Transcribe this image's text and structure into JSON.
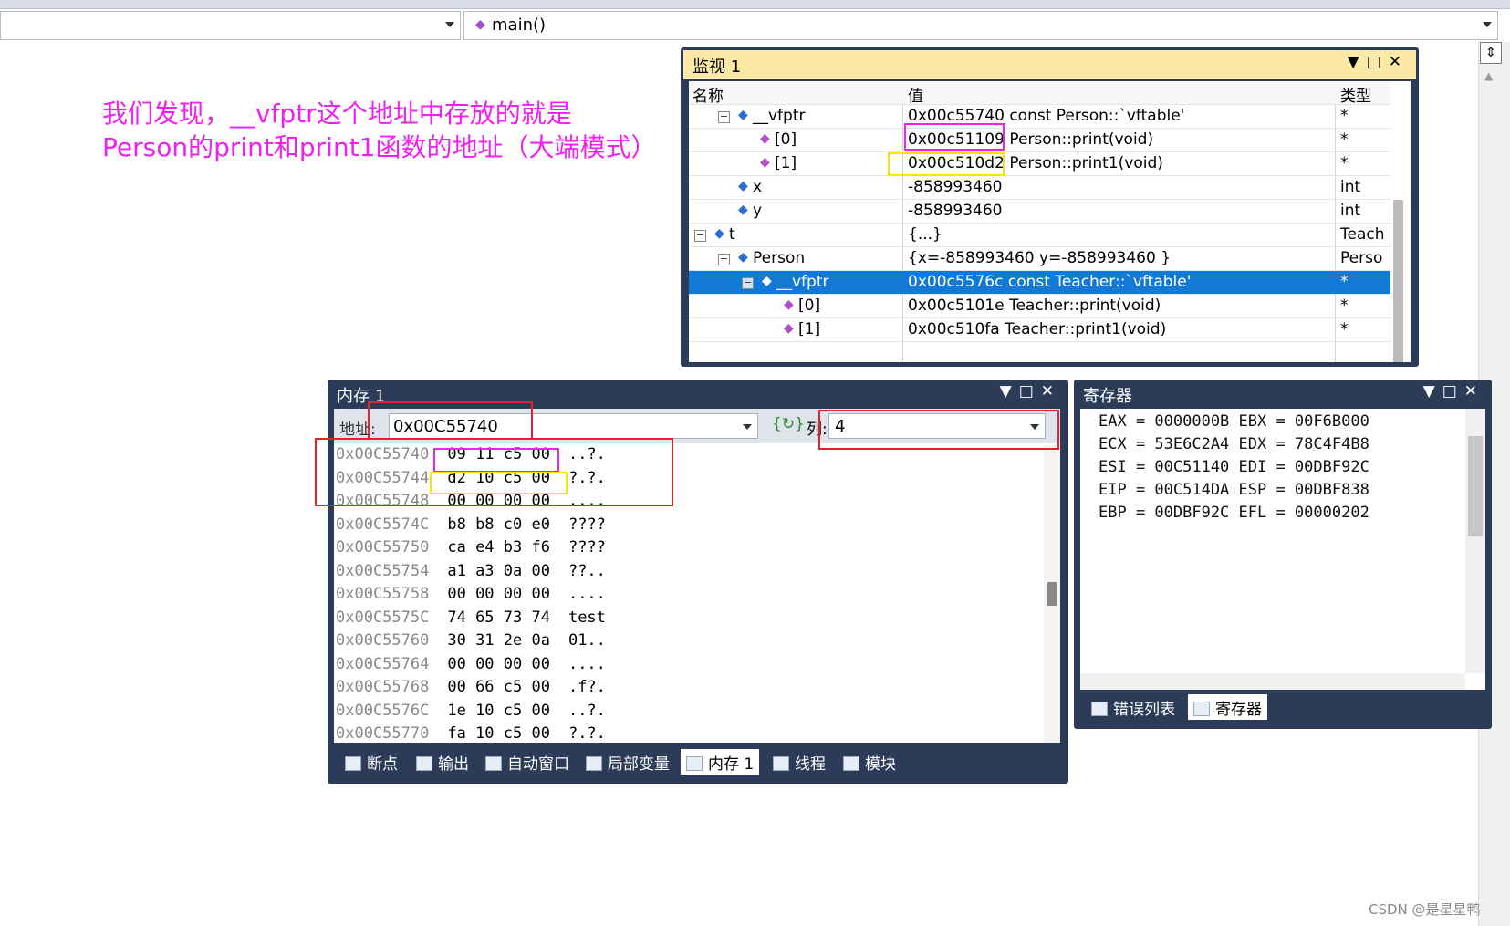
{
  "toolbar": {
    "function_combo": "main()"
  },
  "annotation": {
    "line1": "我们发现，__vfptr这个地址中存放的就是",
    "line2": "Person的print和print1函数的地址（大端模式）"
  },
  "watch": {
    "title": "监视 1",
    "headers": {
      "name": "名称",
      "value": "值",
      "type": "类型"
    },
    "rows": [
      {
        "name": "__vfptr",
        "value": "0x00c55740 const Person::`vftable'",
        "type": "*"
      },
      {
        "name": "[0]",
        "value": "0x00c51109 Person::print(void)",
        "type": "*"
      },
      {
        "name": "[1]",
        "value": "0x00c510d2 Person::print1(void)",
        "type": "*"
      },
      {
        "name": "x",
        "value": "-858993460",
        "type": "int"
      },
      {
        "name": "y",
        "value": "-858993460",
        "type": "int"
      },
      {
        "name": "t",
        "value": "{...}",
        "type": "Teach"
      },
      {
        "name": "Person",
        "value": "{x=-858993460 y=-858993460 }",
        "type": "Perso"
      },
      {
        "name": "__vfptr",
        "value": "0x00c5576c const Teacher::`vftable'",
        "type": "*"
      },
      {
        "name": "[0]",
        "value": "0x00c5101e Teacher::print(void)",
        "type": "*"
      },
      {
        "name": "[1]",
        "value": "0x00c510fa Teacher::print1(void)",
        "type": "*"
      }
    ]
  },
  "memory": {
    "title": "内存 1",
    "address_label": "地址:",
    "address_value": "0x00C55740",
    "columns_label": "列:",
    "columns_value": "4",
    "lines": [
      {
        "addr": "0x00C55740",
        "bytes": "09 11 c5 00",
        "chars": "..?."
      },
      {
        "addr": "0x00C55744",
        "bytes": "d2 10 c5 00",
        "chars": "?.?."
      },
      {
        "addr": "0x00C55748",
        "bytes": "00 00 00 00",
        "chars": "...."
      },
      {
        "addr": "0x00C5574C",
        "bytes": "b8 b8 c0 e0",
        "chars": "????"
      },
      {
        "addr": "0x00C55750",
        "bytes": "ca e4 b3 f6",
        "chars": "????"
      },
      {
        "addr": "0x00C55754",
        "bytes": "a1 a3 0a 00",
        "chars": "??.."
      },
      {
        "addr": "0x00C55758",
        "bytes": "00 00 00 00",
        "chars": "...."
      },
      {
        "addr": "0x00C5575C",
        "bytes": "74 65 73 74",
        "chars": "test"
      },
      {
        "addr": "0x00C55760",
        "bytes": "30 31 2e 0a",
        "chars": "01.."
      },
      {
        "addr": "0x00C55764",
        "bytes": "00 00 00 00",
        "chars": "...."
      },
      {
        "addr": "0x00C55768",
        "bytes": "00 66 c5 00",
        "chars": ".f?."
      },
      {
        "addr": "0x00C5576C",
        "bytes": "1e 10 c5 00",
        "chars": "..?."
      },
      {
        "addr": "0x00C55770",
        "bytes": "fa 10 c5 00",
        "chars": "?.?."
      }
    ],
    "tabs": [
      "断点",
      "输出",
      "自动窗口",
      "局部变量",
      "内存 1",
      "线程",
      "模块"
    ]
  },
  "registers": {
    "title": "寄存器",
    "lines": [
      "EAX = 0000000B EBX = 00F6B000",
      "ECX = 53E6C2A4 EDX = 78C4F4B8",
      "ESI = 00C51140 EDI = 00DBF92C",
      "EIP = 00C514DA ESP = 00DBF838",
      "EBP = 00DBF92C EFL = 00000202"
    ],
    "tabs": [
      "错误列表",
      "寄存器"
    ]
  },
  "colors": {
    "magenta": "#f020f0",
    "yellow": "#f5e600",
    "red": "#e8202a",
    "selection": "#1379d6"
  },
  "watermark": "CSDN @是星星鸭"
}
